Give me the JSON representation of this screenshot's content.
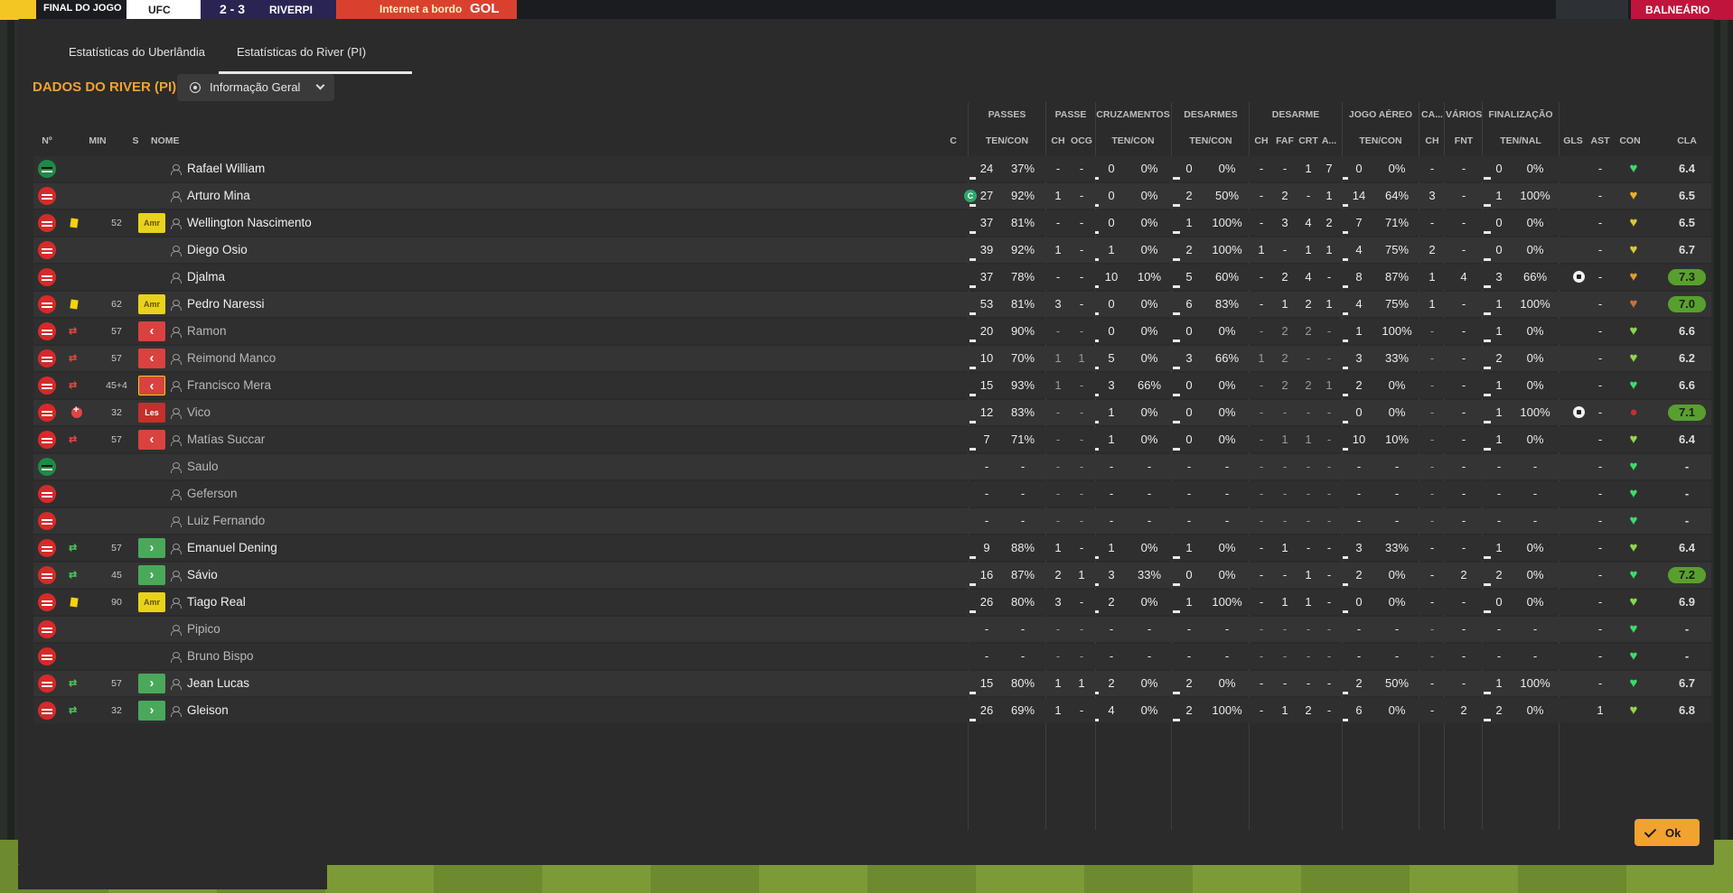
{
  "topbar": {
    "stage": "FINAL DO JOGO",
    "home": "UFC",
    "score": "2 - 3",
    "away": "RIVERPI",
    "ad_text": "Internet a bordo",
    "ad_brand": "GOL",
    "locker": "BALNEÁRIO"
  },
  "tabs": [
    {
      "label": "Estatísticas do Uberlândia"
    },
    {
      "label": "Estatísticas do River (PI)"
    }
  ],
  "section": {
    "title": "DADOS DO RIVER (PI)",
    "view_select": "Informação Geral"
  },
  "group_headers": {
    "passes": "PASSES",
    "passe": "PASSE",
    "cruzamentos": "CRUZAMENTOS",
    "desarmes": "DESARMES",
    "desarme": "DESARME",
    "jogo_aereo": "JOGO AÉREO",
    "ca": "CA...",
    "varios": "VÁRIOS",
    "finalizacao": "FINALIZAÇÃO"
  },
  "columns": {
    "num": "Nº",
    "min": "MIN",
    "s": "S",
    "name": "NOME",
    "c": "C",
    "passes": "TEN/CON",
    "passe_ch": "CH",
    "passe_ocg": "OCG",
    "cruz": "TEN/CON",
    "des": "TEN/CON",
    "d_ch": "CH",
    "d_faf": "FAF",
    "d_crt": "CRT",
    "d_a": "A...",
    "aereo": "TEN/CON",
    "ca_ch": "CH",
    "fnt": "FNT",
    "fin": "TEN/NAL",
    "gls": "GLS",
    "ast": "AST",
    "con": "CON",
    "cla": "CLA"
  },
  "players": [
    {
      "name": "Rafael William",
      "shirt": "gk",
      "event": "",
      "min": "",
      "status": "",
      "cap": "",
      "p": [
        "24",
        "37%"
      ],
      "pch": "-",
      "pocg": "-",
      "cr": [
        "0",
        "0%"
      ],
      "de": [
        "0",
        "0%"
      ],
      "dch": "-",
      "faf": "-",
      "crt": "1",
      "a": "7",
      "ae": [
        "0",
        "0%"
      ],
      "cach": "-",
      "fnt": "-",
      "fi": [
        "0",
        "0%"
      ],
      "gls": "",
      "ast": "-",
      "con": "green",
      "cla": "6.4",
      "hi": false,
      "dim": false
    },
    {
      "name": "Arturo Mina",
      "shirt": "field",
      "event": "",
      "min": "",
      "status": "",
      "cap": "C",
      "p": [
        "27",
        "92%"
      ],
      "pch": "1",
      "pocg": "-",
      "cr": [
        "0",
        "0%"
      ],
      "de": [
        "2",
        "50%"
      ],
      "dch": "-",
      "faf": "2",
      "crt": "-",
      "a": "1",
      "ae": [
        "14",
        "64%"
      ],
      "cach": "3",
      "fnt": "-",
      "fi": [
        "1",
        "100%"
      ],
      "gls": "",
      "ast": "-",
      "con": "amber",
      "cla": "6.5",
      "hi": false,
      "dim": false
    },
    {
      "name": "Wellington Nascimento",
      "shirt": "field",
      "event": "yellow",
      "min": "52",
      "status": "Amr",
      "cap": "",
      "p": [
        "37",
        "81%"
      ],
      "pch": "-",
      "pocg": "-",
      "cr": [
        "0",
        "0%"
      ],
      "de": [
        "1",
        "100%"
      ],
      "dch": "-",
      "faf": "3",
      "crt": "4",
      "a": "2",
      "ae": [
        "7",
        "71%"
      ],
      "cach": "-",
      "fnt": "-",
      "fi": [
        "0",
        "0%"
      ],
      "gls": "",
      "ast": "-",
      "con": "yellow",
      "cla": "6.5",
      "hi": false,
      "dim": false
    },
    {
      "name": "Diego Osio",
      "shirt": "field",
      "event": "",
      "min": "",
      "status": "",
      "cap": "",
      "p": [
        "39",
        "92%"
      ],
      "pch": "1",
      "pocg": "-",
      "cr": [
        "1",
        "0%"
      ],
      "de": [
        "2",
        "100%"
      ],
      "dch": "1",
      "faf": "-",
      "crt": "1",
      "a": "1",
      "ae": [
        "4",
        "75%"
      ],
      "cach": "2",
      "fnt": "-",
      "fi": [
        "0",
        "0%"
      ],
      "gls": "",
      "ast": "-",
      "con": "yellow",
      "cla": "6.7",
      "hi": false,
      "dim": false
    },
    {
      "name": "Djalma",
      "shirt": "field",
      "event": "",
      "min": "",
      "status": "",
      "cap": "",
      "p": [
        "37",
        "78%"
      ],
      "pch": "-",
      "pocg": "-",
      "cr": [
        "10",
        "10%"
      ],
      "de": [
        "5",
        "60%"
      ],
      "dch": "-",
      "faf": "2",
      "crt": "4",
      "a": "-",
      "ae": [
        "8",
        "87%"
      ],
      "cach": "1",
      "fnt": "4",
      "fi": [
        "3",
        "66%"
      ],
      "gls": "goal",
      "ast": "-",
      "con": "orange",
      "cla": "7.3",
      "hi": true,
      "dim": false
    },
    {
      "name": "Pedro Naressi",
      "shirt": "field",
      "event": "yellow",
      "min": "62",
      "status": "Amr",
      "cap": "",
      "p": [
        "53",
        "81%"
      ],
      "pch": "3",
      "pocg": "-",
      "cr": [
        "0",
        "0%"
      ],
      "de": [
        "6",
        "83%"
      ],
      "dch": "-",
      "faf": "1",
      "crt": "2",
      "a": "1",
      "ae": [
        "4",
        "75%"
      ],
      "cach": "1",
      "fnt": "-",
      "fi": [
        "1",
        "100%"
      ],
      "gls": "",
      "ast": "-",
      "con": "brown",
      "cla": "7.0",
      "hi": true,
      "dim": false
    },
    {
      "name": "Ramon",
      "shirt": "field",
      "event": "subout",
      "min": "57",
      "status": "out",
      "cap": "",
      "p": [
        "20",
        "90%"
      ],
      "pch": "-",
      "pocg": "-",
      "cr": [
        "0",
        "0%"
      ],
      "de": [
        "0",
        "0%"
      ],
      "dch": "-",
      "faf": "2",
      "crt": "2",
      "a": "-",
      "ae": [
        "1",
        "100%"
      ],
      "cach": "-",
      "fnt": "-",
      "fi": [
        "1",
        "0%"
      ],
      "gls": "",
      "ast": "-",
      "con": "lime",
      "cla": "6.6",
      "hi": false,
      "dim": true
    },
    {
      "name": "Reimond Manco",
      "shirt": "field",
      "event": "subout",
      "min": "57",
      "status": "out",
      "cap": "",
      "p": [
        "10",
        "70%"
      ],
      "pch": "1",
      "pocg": "1",
      "cr": [
        "5",
        "0%"
      ],
      "de": [
        "3",
        "66%"
      ],
      "dch": "1",
      "faf": "2",
      "crt": "-",
      "a": "-",
      "ae": [
        "3",
        "33%"
      ],
      "cach": "-",
      "fnt": "-",
      "fi": [
        "2",
        "0%"
      ],
      "gls": "",
      "ast": "-",
      "con": "lime",
      "cla": "6.2",
      "hi": false,
      "dim": true
    },
    {
      "name": "Francisco Mera",
      "shirt": "field",
      "event": "subout",
      "min": "45+4",
      "status": "outy",
      "cap": "",
      "p": [
        "15",
        "93%"
      ],
      "pch": "1",
      "pocg": "-",
      "cr": [
        "3",
        "66%"
      ],
      "de": [
        "0",
        "0%"
      ],
      "dch": "-",
      "faf": "2",
      "crt": "2",
      "a": "1",
      "ae": [
        "2",
        "0%"
      ],
      "cach": "-",
      "fnt": "-",
      "fi": [
        "1",
        "0%"
      ],
      "gls": "",
      "ast": "-",
      "con": "green",
      "cla": "6.6",
      "hi": false,
      "dim": true
    },
    {
      "name": "Vico",
      "shirt": "field",
      "event": "injury",
      "min": "32",
      "status": "Les",
      "cap": "",
      "p": [
        "12",
        "83%"
      ],
      "pch": "-",
      "pocg": "-",
      "cr": [
        "1",
        "0%"
      ],
      "de": [
        "0",
        "0%"
      ],
      "dch": "-",
      "faf": "-",
      "crt": "-",
      "a": "-",
      "ae": [
        "0",
        "0%"
      ],
      "cach": "-",
      "fnt": "-",
      "fi": [
        "1",
        "100%"
      ],
      "gls": "goal",
      "ast": "-",
      "con": "injured",
      "cla": "7.1",
      "hi": true,
      "dim": true
    },
    {
      "name": "Matías Succar",
      "shirt": "field",
      "event": "subout",
      "min": "57",
      "status": "out",
      "cap": "",
      "p": [
        "7",
        "71%"
      ],
      "pch": "-",
      "pocg": "-",
      "cr": [
        "1",
        "0%"
      ],
      "de": [
        "0",
        "0%"
      ],
      "dch": "-",
      "faf": "1",
      "crt": "1",
      "a": "-",
      "ae": [
        "10",
        "10%"
      ],
      "cach": "-",
      "fnt": "-",
      "fi": [
        "1",
        "0%"
      ],
      "gls": "",
      "ast": "-",
      "con": "lime",
      "cla": "6.4",
      "hi": false,
      "dim": true
    },
    {
      "name": "Saulo",
      "shirt": "gk",
      "event": "",
      "min": "",
      "status": "",
      "cap": "",
      "p": [
        "-",
        "-"
      ],
      "pch": "-",
      "pocg": "-",
      "cr": [
        "-",
        "-"
      ],
      "de": [
        "-",
        "-"
      ],
      "dch": "-",
      "faf": "-",
      "crt": "-",
      "a": "-",
      "ae": [
        "-",
        "-"
      ],
      "cach": "-",
      "fnt": "-",
      "fi": [
        "-",
        "-"
      ],
      "gls": "",
      "ast": "-",
      "con": "green",
      "cla": "-",
      "hi": false,
      "dim": true
    },
    {
      "name": "Geferson",
      "shirt": "field",
      "event": "",
      "min": "",
      "status": "",
      "cap": "",
      "p": [
        "-",
        "-"
      ],
      "pch": "-",
      "pocg": "-",
      "cr": [
        "-",
        "-"
      ],
      "de": [
        "-",
        "-"
      ],
      "dch": "-",
      "faf": "-",
      "crt": "-",
      "a": "-",
      "ae": [
        "-",
        "-"
      ],
      "cach": "-",
      "fnt": "-",
      "fi": [
        "-",
        "-"
      ],
      "gls": "",
      "ast": "-",
      "con": "green",
      "cla": "-",
      "hi": false,
      "dim": true
    },
    {
      "name": "Luiz Fernando",
      "shirt": "field",
      "event": "",
      "min": "",
      "status": "",
      "cap": "",
      "p": [
        "-",
        "-"
      ],
      "pch": "-",
      "pocg": "-",
      "cr": [
        "-",
        "-"
      ],
      "de": [
        "-",
        "-"
      ],
      "dch": "-",
      "faf": "-",
      "crt": "-",
      "a": "-",
      "ae": [
        "-",
        "-"
      ],
      "cach": "-",
      "fnt": "-",
      "fi": [
        "-",
        "-"
      ],
      "gls": "",
      "ast": "-",
      "con": "green",
      "cla": "-",
      "hi": false,
      "dim": true
    },
    {
      "name": "Emanuel Dening",
      "shirt": "field",
      "event": "subin",
      "min": "57",
      "status": "in",
      "cap": "",
      "p": [
        "9",
        "88%"
      ],
      "pch": "1",
      "pocg": "-",
      "cr": [
        "1",
        "0%"
      ],
      "de": [
        "1",
        "0%"
      ],
      "dch": "-",
      "faf": "1",
      "crt": "-",
      "a": "-",
      "ae": [
        "3",
        "33%"
      ],
      "cach": "-",
      "fnt": "-",
      "fi": [
        "1",
        "0%"
      ],
      "gls": "",
      "ast": "-",
      "con": "lime",
      "cla": "6.4",
      "hi": false,
      "dim": false
    },
    {
      "name": "Sávio",
      "shirt": "field",
      "event": "subin",
      "min": "45",
      "status": "in",
      "cap": "",
      "p": [
        "16",
        "87%"
      ],
      "pch": "2",
      "pocg": "1",
      "cr": [
        "3",
        "33%"
      ],
      "de": [
        "0",
        "0%"
      ],
      "dch": "-",
      "faf": "-",
      "crt": "1",
      "a": "-",
      "ae": [
        "2",
        "0%"
      ],
      "cach": "-",
      "fnt": "2",
      "fi": [
        "2",
        "0%"
      ],
      "gls": "",
      "ast": "-",
      "con": "green",
      "cla": "7.2",
      "hi": true,
      "dim": false
    },
    {
      "name": "Tiago Real",
      "shirt": "field",
      "event": "yellow",
      "min": "90",
      "status": "Amr",
      "cap": "",
      "p": [
        "26",
        "80%"
      ],
      "pch": "3",
      "pocg": "-",
      "cr": [
        "2",
        "0%"
      ],
      "de": [
        "1",
        "100%"
      ],
      "dch": "-",
      "faf": "1",
      "crt": "1",
      "a": "-",
      "ae": [
        "0",
        "0%"
      ],
      "cach": "-",
      "fnt": "-",
      "fi": [
        "0",
        "0%"
      ],
      "gls": "",
      "ast": "-",
      "con": "lime",
      "cla": "6.9",
      "hi": false,
      "dim": false
    },
    {
      "name": "Pipico",
      "shirt": "field",
      "event": "",
      "min": "",
      "status": "",
      "cap": "",
      "p": [
        "-",
        "-"
      ],
      "pch": "-",
      "pocg": "-",
      "cr": [
        "-",
        "-"
      ],
      "de": [
        "-",
        "-"
      ],
      "dch": "-",
      "faf": "-",
      "crt": "-",
      "a": "-",
      "ae": [
        "-",
        "-"
      ],
      "cach": "-",
      "fnt": "-",
      "fi": [
        "-",
        "-"
      ],
      "gls": "",
      "ast": "-",
      "con": "green",
      "cla": "-",
      "hi": false,
      "dim": true
    },
    {
      "name": "Bruno Bispo",
      "shirt": "field",
      "event": "",
      "min": "",
      "status": "",
      "cap": "",
      "p": [
        "-",
        "-"
      ],
      "pch": "-",
      "pocg": "-",
      "cr": [
        "-",
        "-"
      ],
      "de": [
        "-",
        "-"
      ],
      "dch": "-",
      "faf": "-",
      "crt": "-",
      "a": "-",
      "ae": [
        "-",
        "-"
      ],
      "cach": "-",
      "fnt": "-",
      "fi": [
        "-",
        "-"
      ],
      "gls": "",
      "ast": "-",
      "con": "green",
      "cla": "-",
      "hi": false,
      "dim": true
    },
    {
      "name": "Jean Lucas",
      "shirt": "field",
      "event": "subin",
      "min": "57",
      "status": "in",
      "cap": "",
      "p": [
        "15",
        "80%"
      ],
      "pch": "1",
      "pocg": "1",
      "cr": [
        "2",
        "0%"
      ],
      "de": [
        "2",
        "0%"
      ],
      "dch": "-",
      "faf": "-",
      "crt": "-",
      "a": "-",
      "ae": [
        "2",
        "50%"
      ],
      "cach": "-",
      "fnt": "-",
      "fi": [
        "1",
        "100%"
      ],
      "gls": "",
      "ast": "-",
      "con": "green",
      "cla": "6.7",
      "hi": false,
      "dim": false
    },
    {
      "name": "Gleison",
      "shirt": "field",
      "event": "subin",
      "min": "32",
      "status": "in",
      "cap": "",
      "p": [
        "26",
        "69%"
      ],
      "pch": "1",
      "pocg": "-",
      "cr": [
        "4",
        "0%"
      ],
      "de": [
        "2",
        "100%"
      ],
      "dch": "-",
      "faf": "1",
      "crt": "2",
      "a": "-",
      "ae": [
        "6",
        "0%"
      ],
      "cach": "-",
      "fnt": "2",
      "fi": [
        "2",
        "0%"
      ],
      "gls": "",
      "ast": "1",
      "con": "lime",
      "cla": "6.8",
      "hi": false,
      "dim": false
    }
  ],
  "ok_label": "Ok",
  "colors": {
    "accent": "#f2a22e",
    "panel": "#2b2b2b",
    "rating_high": "#58a02e",
    "yellow_card": "#e8d21c",
    "sub_out": "#d9423f",
    "sub_in": "#4aa85a"
  }
}
